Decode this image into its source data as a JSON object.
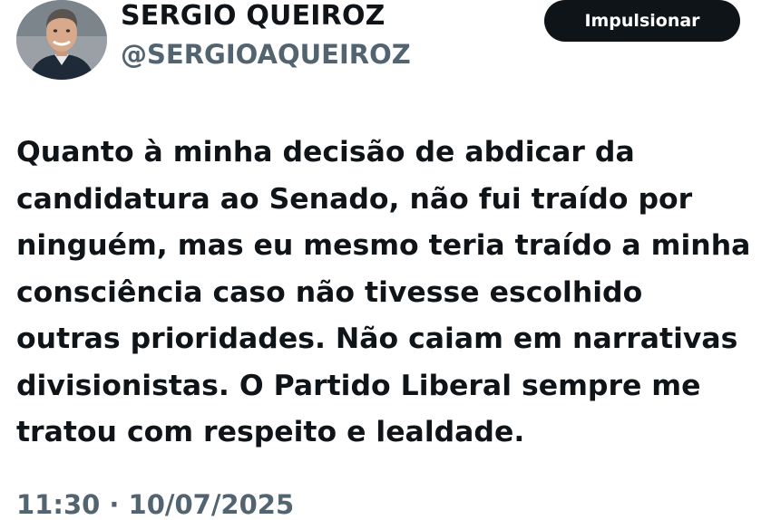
{
  "author": {
    "display_name": "SERGIO QUEIROZ",
    "handle": "@SERGIOAQUEIROZ",
    "avatar_icon": "profile-photo"
  },
  "actions": {
    "boost_label": "Impulsionar"
  },
  "tweet": {
    "lines": [
      "Quanto à minha decisão de abdicar da",
      "candidatura ao Senado, não fui traído por",
      "ninguém, mas eu mesmo teria traído a minha",
      "consciência caso não tivesse escolhido",
      "outras prioridades. Não caiam em narrativas",
      "divisionistas. O Partido Liberal sempre me",
      "tratou com respeito e lealdade."
    ],
    "timestamp": "11:30 · 10/07/2025"
  },
  "colors": {
    "text": "#0f1419",
    "secondary_text": "#536471",
    "button_bg": "#0f1419",
    "button_text": "#ffffff",
    "background": "#ffffff"
  }
}
